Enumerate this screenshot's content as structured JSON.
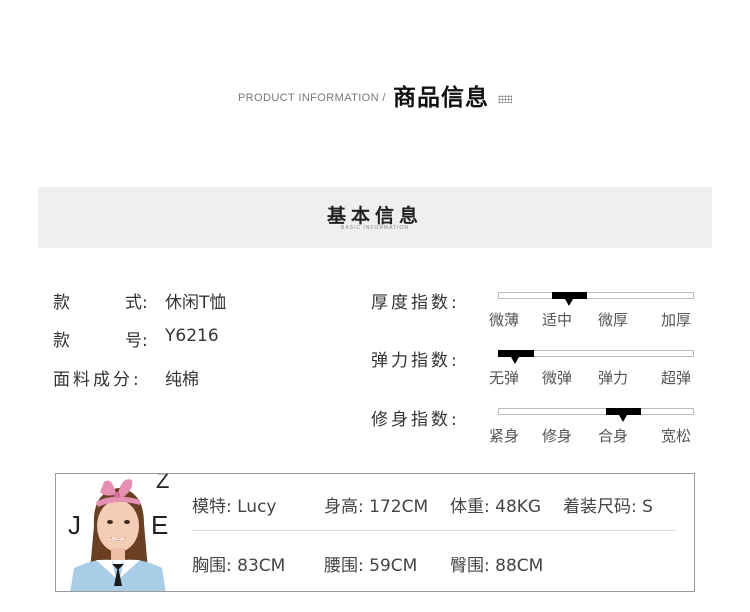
{
  "header": {
    "en": "PRODUCT INFORMATION /",
    "cn": "商品信息"
  },
  "basic": {
    "title": "基本信息",
    "subtitle": "BASIC INFORMATION"
  },
  "attributes": [
    {
      "label_chars": [
        "款",
        "式:"
      ],
      "value": "休闲T恤"
    },
    {
      "label_chars": [
        "款",
        "号:"
      ],
      "value": "Y6216"
    },
    {
      "label": "面料成分:",
      "value": "纯棉"
    }
  ],
  "indices": [
    {
      "label": "厚度指数:",
      "options": [
        "微薄",
        "适中",
        "微厚",
        "加厚"
      ],
      "selected_index": 1
    },
    {
      "label": "弹力指数:",
      "options": [
        "无弹",
        "微弹",
        "弹力",
        "超弹"
      ],
      "selected_index": 0
    },
    {
      "label": "修身指数:",
      "options": [
        "紧身",
        "修身",
        "合身",
        "宽松"
      ],
      "selected_index": 2
    }
  ],
  "model": {
    "name": "模特: Lucy",
    "height": "身高: 172CM",
    "weight": "体重: 48KG",
    "size": "着装尺码: S",
    "chest": "胸围: 83CM",
    "waist": "腰围: 59CM",
    "hip": "臀围: 88CM",
    "photo_bg_letters": "J E Z"
  },
  "colors": {
    "band_bg": "#efefef",
    "indicator": "#000000",
    "card_border": "#9a9a9a"
  }
}
